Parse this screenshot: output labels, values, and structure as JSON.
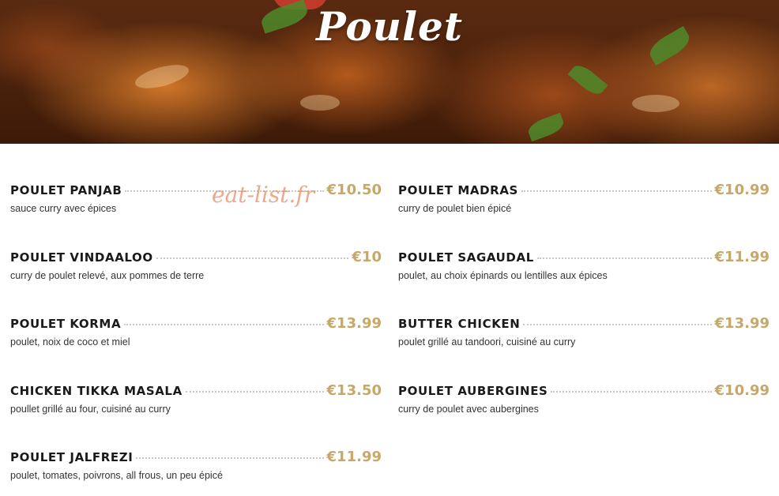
{
  "header": {
    "title": "Poulet"
  },
  "watermark": "eat-list.fr",
  "colors": {
    "price": "#c6a869",
    "name": "#1a1a1a",
    "desc": "#333333",
    "watermark": "#e68c64"
  },
  "menu": {
    "left": [
      {
        "name": "POULET PANJAB",
        "price": "€10.50",
        "desc": "sauce curry avec épices"
      },
      {
        "name": "POULET VINDAALOO",
        "price": "€10",
        "desc": "curry de poulet relevé, aux pommes de terre"
      },
      {
        "name": "POULET KORMA",
        "price": "€13.99",
        "desc": "poulet, noix de coco et miel"
      },
      {
        "name": "CHICKEN TIKKA MASALA",
        "price": "€13.50",
        "desc": "poullet grillé au four, cuisiné au curry"
      },
      {
        "name": "POULET JALFREZI",
        "price": "€11.99",
        "desc": "poulet, tomates, poivrons, all frous, un peu épicé"
      }
    ],
    "right": [
      {
        "name": "POULET MADRAS",
        "price": "€10.99",
        "desc": "curry de poulet bien épicé"
      },
      {
        "name": "POULET SAGAUDAL",
        "price": "€11.99",
        "desc": "poulet, au choix épinards ou lentilles aux épices"
      },
      {
        "name": "BUTTER CHICKEN",
        "price": "€13.99",
        "desc": "poulet grillé au tandoori, cuisiné au curry"
      },
      {
        "name": "POULET AUBERGINES",
        "price": "€10.99",
        "desc": "curry de poulet avec aubergines"
      }
    ]
  }
}
